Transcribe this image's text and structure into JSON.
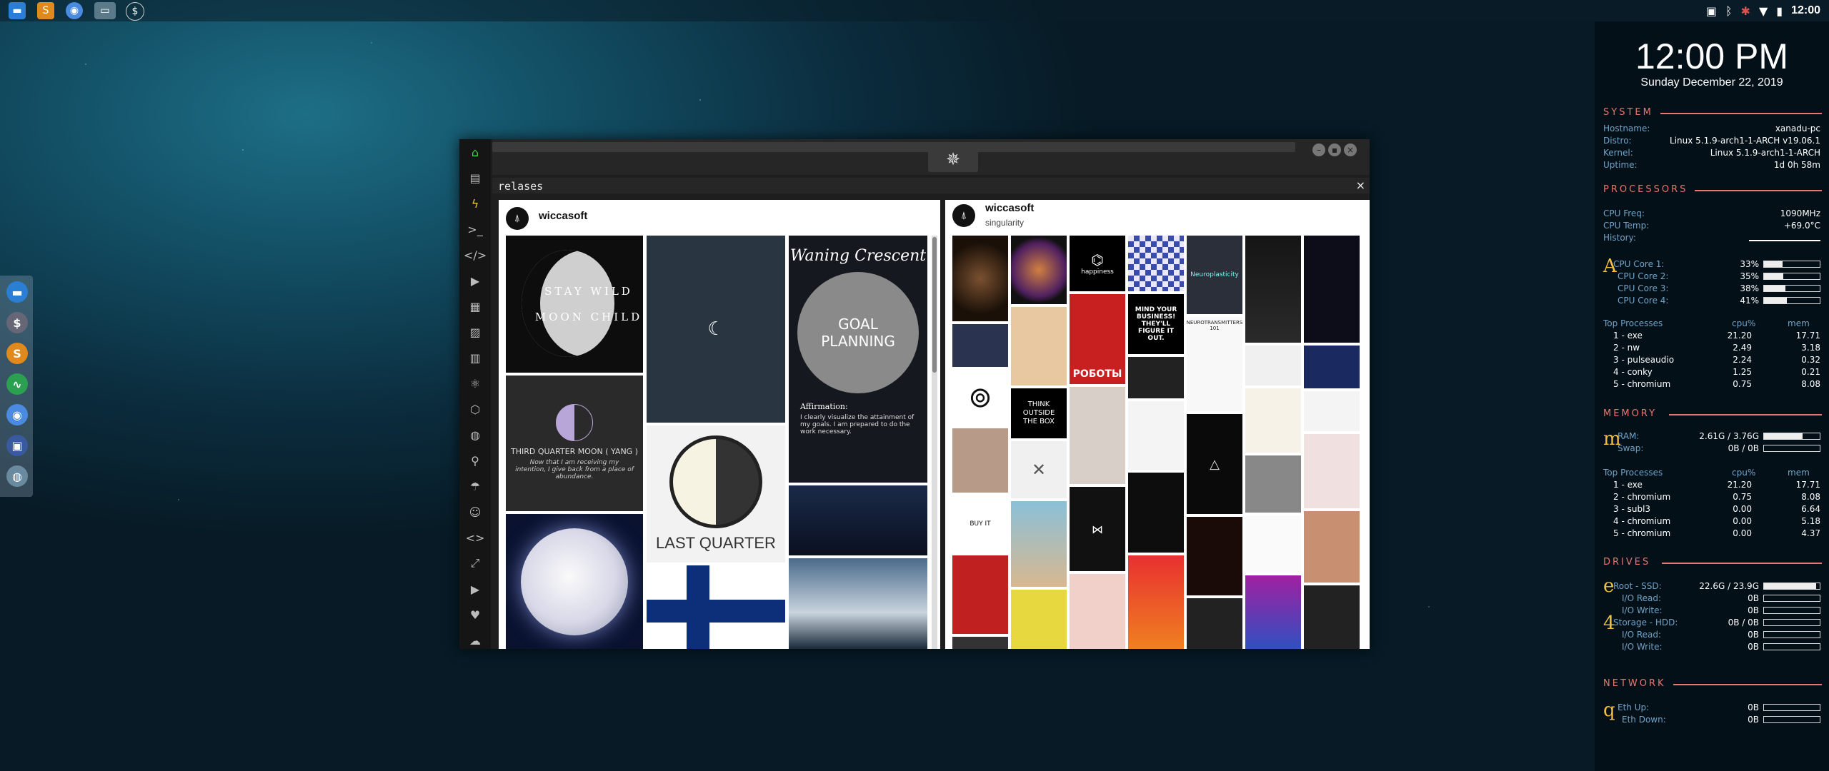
{
  "topbar": {
    "launchers": [
      "files-icon",
      "sublime-icon",
      "chromium-icon",
      "desktop-icon",
      "app-icon"
    ],
    "time": "12:00"
  },
  "dock": {
    "items": [
      "files-icon",
      "finance-icon",
      "sublime-icon",
      "monitor-icon",
      "chrome-icon",
      "screen-icon",
      "globe-icon"
    ]
  },
  "app": {
    "panel_title": "relases",
    "close_glyph": "×",
    "board_left": {
      "user": "wiccasoft"
    },
    "board_right": {
      "user": "wiccasoft",
      "subtitle": "singularity"
    },
    "left_tiles": {
      "moon_child": "STAY WILD\nMOON CHILD",
      "third_quarter_title": "THIRD QUARTER MOON ( YANG )",
      "third_quarter_body": "Now that I am receiving my intention, I give back from a place of abundance.",
      "waning_title": "Waning Crescent",
      "goal": "GOAL PLANNING",
      "affirmation_title": "Affirmation:",
      "affirmation_body": "I clearly visualize the attainment of my goals. I am prepared to do the work necessary.",
      "last_quarter": "LAST QUARTER"
    },
    "right_tiles": {
      "happiness": "happiness",
      "mind_business": "MIND YOUR BUSINESS! THEY'LL FIGURE IT OUT.",
      "neuroplasticity": "Neuroplasticity",
      "roboty": "РОБОТЫ",
      "think": "THINK OUTSIDE THE BOX",
      "buy_it": "BUY IT",
      "neurotransmitters": "NEUROTRANSMITTERS 101"
    }
  },
  "conky": {
    "time": "12:00 PM",
    "date": "Sunday December 22, 2019",
    "system": {
      "title": "SYSTEM",
      "rows": [
        {
          "k": "Hostname:",
          "v": "xanadu-pc"
        },
        {
          "k": "Distro:",
          "v": "Linux 5.1.9-arch1-1-ARCH v19.06.1"
        },
        {
          "k": "Kernel:",
          "v": "Linux 5.1.9-arch1-1-ARCH"
        },
        {
          "k": "Uptime:",
          "v": "1d 0h 58m"
        }
      ]
    },
    "processors": {
      "title": "PROCESSORS",
      "freq_label": "CPU Freq:",
      "freq": "1090MHz",
      "temp_label": "CPU Temp:",
      "temp": "+69.0°C",
      "history_label": "History:",
      "letter": "A",
      "cores": [
        {
          "label": "CPU Core 1:",
          "value": "33%",
          "pct": 33
        },
        {
          "label": "CPU Core 2:",
          "value": "35%",
          "pct": 35
        },
        {
          "label": "CPU Core 3:",
          "value": "38%",
          "pct": 38
        },
        {
          "label": "CPU Core 4:",
          "value": "41%",
          "pct": 41
        }
      ],
      "top_label": "Top Processes",
      "col_cpu": "cpu%",
      "col_mem": "mem",
      "procs": [
        {
          "n": "1 - exe",
          "cpu": "21.20",
          "mem": "17.71"
        },
        {
          "n": "2 - nw",
          "cpu": "2.49",
          "mem": "3.18"
        },
        {
          "n": "3 - pulseaudio",
          "cpu": "2.24",
          "mem": "0.32"
        },
        {
          "n": "4 - conky",
          "cpu": "1.25",
          "mem": "0.21"
        },
        {
          "n": "5 - chromium",
          "cpu": "0.75",
          "mem": "8.08"
        }
      ]
    },
    "memory": {
      "title": "MEMORY",
      "letter": "m",
      "ram_label": "RAM:",
      "ram": "2.61G / 3.76G",
      "ram_pct": 69,
      "swap_label": "Swap:",
      "swap": "0B / 0B",
      "swap_pct": 0,
      "top_label": "Top Processes",
      "col_cpu": "cpu%",
      "col_mem": "mem",
      "procs": [
        {
          "n": "1 - exe",
          "cpu": "21.20",
          "mem": "17.71"
        },
        {
          "n": "2 - chromium",
          "cpu": "0.75",
          "mem": "8.08"
        },
        {
          "n": "3 - subl3",
          "cpu": "0.00",
          "mem": "6.64"
        },
        {
          "n": "4 - chromium",
          "cpu": "0.00",
          "mem": "5.18"
        },
        {
          "n": "5 - chromium",
          "cpu": "0.00",
          "mem": "4.37"
        }
      ]
    },
    "drives": {
      "title": "DRIVES",
      "root_letter": "e",
      "root_label": "Root - SSD:",
      "root": "22.6G / 23.9G",
      "root_pct": 94,
      "root_read_label": "I/O Read:",
      "root_read": "0B",
      "root_write_label": "I/O Write:",
      "root_write": "0B",
      "storage_letter": "4",
      "storage_label": "Storage - HDD:",
      "storage": "0B / 0B",
      "storage_pct": 0,
      "storage_read_label": "I/O Read:",
      "storage_read": "0B",
      "storage_write_label": "I/O Write:",
      "storage_write": "0B"
    },
    "network": {
      "title": "NETWORK",
      "letter": "q",
      "up_label": "Eth Up:",
      "up": "0B",
      "down_label": "Eth Down:",
      "down": "0B"
    }
  }
}
